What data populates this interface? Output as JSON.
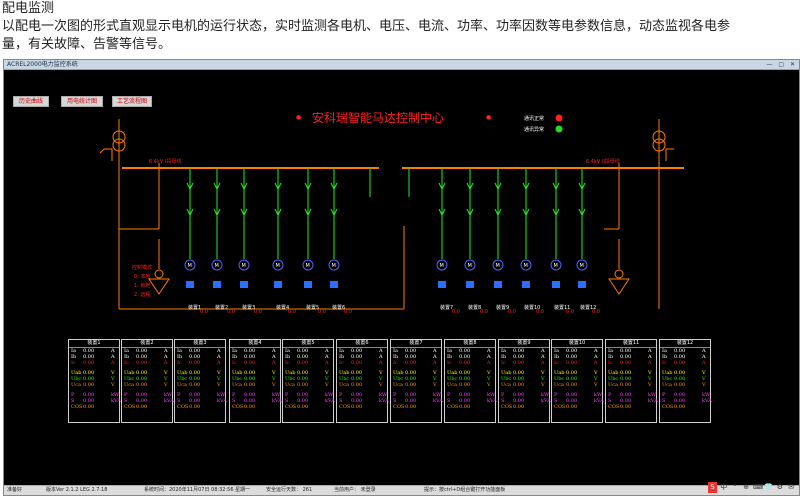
{
  "page": {
    "heading": "配电监测",
    "desc_line1": "以配电一次图的形式直观显示电机的运行状态，实时监测各电机、电压、电流、功率、功率因数等电参数信息，动态监视各电参",
    "desc_line2": "量，有关故障、告警等信号。"
  },
  "window": {
    "title": "ACREL2000电力监控系统",
    "buttons": [
      "历史曲线",
      "用电统计图",
      "工艺流程图"
    ],
    "main_title": "安科瑞智能马达控制中心",
    "legend": [
      {
        "label": "通讯正常",
        "color": "#ff2020"
      },
      {
        "label": "通讯异常",
        "color": "#22dd22"
      }
    ],
    "bus_left": "6.4kV I段母线",
    "bus_right": "6.4kV II段母线",
    "ctrl_mode": {
      "title": "控制模式",
      "items": [
        "0: 本地",
        "1: 就地",
        "2: 远程"
      ]
    },
    "device_labels": [
      "装置1",
      "装置2",
      "装置3",
      "装置4",
      "装置5",
      "装置6",
      "装置7",
      "装置8",
      "装置9",
      "装置10",
      "装置11",
      "装置12"
    ],
    "device_readings": [
      "0.0",
      "0.0",
      "0.0",
      "0.0",
      "0.0",
      "0.0",
      "0.0",
      "0.0",
      "0.0",
      "0.0",
      "0.0",
      "0.0"
    ]
  },
  "colors": {
    "cyan": "#00e5ff",
    "green": "#22ee22",
    "red": "#ff2020",
    "yellow": "#ffff00",
    "magenta": "#ff40ff",
    "orange": "#ff9900",
    "bus_orange": "#ff7b00",
    "blue_circle": "#5560ff"
  },
  "panels": [
    {
      "name": "装置1"
    },
    {
      "name": "装置2"
    },
    {
      "name": "装置3"
    },
    {
      "name": "装置4"
    },
    {
      "name": "装置5"
    },
    {
      "name": "装置6"
    },
    {
      "name": "装置7"
    },
    {
      "name": "装置8"
    },
    {
      "name": "装置9"
    },
    {
      "name": "装置10"
    },
    {
      "name": "装置11"
    },
    {
      "name": "装置12"
    }
  ],
  "panel_rows": [
    {
      "label": "Ia",
      "value": "0.00",
      "unit": "A",
      "color": "#ffffff",
      "group": 1
    },
    {
      "label": "Ib",
      "value": "0.00",
      "unit": "A",
      "color": "#ffffff",
      "group": 1
    },
    {
      "label": "Ic",
      "value": "0.00",
      "unit": "A",
      "color": "#ff2020",
      "group": 1
    },
    {
      "label": "Uab",
      "value": "0.00",
      "unit": "V",
      "color": "#ffff00",
      "group": 2
    },
    {
      "label": "Ubc",
      "value": "0.00",
      "unit": "V",
      "color": "#22ee22",
      "group": 2
    },
    {
      "label": "Uca",
      "value": "0.00",
      "unit": "V",
      "color": "#ff9900",
      "group": 2
    },
    {
      "label": "P",
      "value": "0.00",
      "unit": "kW",
      "color": "#ff40ff",
      "group": 3
    },
    {
      "label": "S",
      "value": "0.00",
      "unit": "kVA",
      "color": "#ff40ff",
      "group": 3
    },
    {
      "label": "COS",
      "value": "0.00",
      "unit": "",
      "color": "#ff9900",
      "group": 3
    }
  ],
  "statusbar": {
    "left": "准备好",
    "version": "版本Ver 2.1.2 LEG 2.7.18",
    "time": "系统时间：2020年11月07日  08:32:56  星期一",
    "days": "安全运行天数： 261",
    "user": "当前用户：  未登录",
    "hint": "提示：按ctrl+D组合键打开功能面板"
  },
  "tray": [
    "S",
    "中",
    "°",
    "⊕",
    "⌨",
    "👕",
    "⚙",
    "✉"
  ]
}
